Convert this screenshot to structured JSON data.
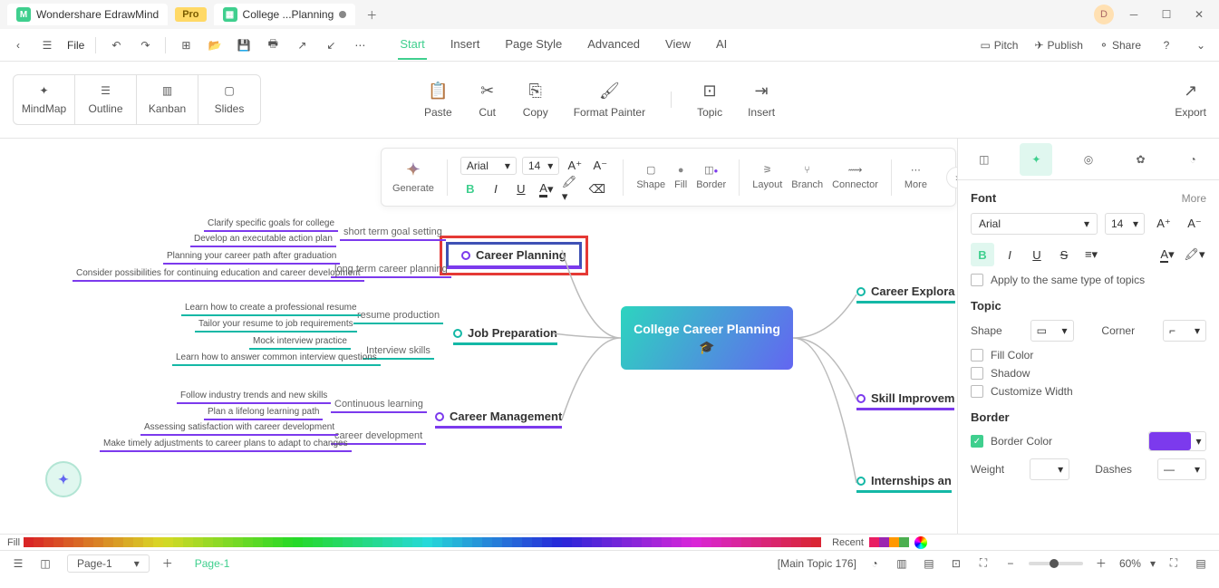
{
  "titlebar": {
    "app_name": "Wondershare EdrawMind",
    "pro_label": "Pro",
    "doc_tab": "College ...Planning",
    "user_initial": "D"
  },
  "menubar": {
    "file": "File",
    "tabs": [
      "Start",
      "Insert",
      "Page Style",
      "Advanced",
      "View",
      "AI"
    ],
    "active_tab": 0,
    "pitch": "Pitch",
    "publish": "Publish",
    "share": "Share"
  },
  "toolbar": {
    "views": [
      "MindMap",
      "Outline",
      "Kanban",
      "Slides"
    ],
    "paste": "Paste",
    "cut": "Cut",
    "copy": "Copy",
    "format_painter": "Format Painter",
    "topic": "Topic",
    "insert": "Insert",
    "export": "Export"
  },
  "float": {
    "generate": "Generate",
    "font_name": "Arial",
    "font_size": "14",
    "shape": "Shape",
    "fill": "Fill",
    "border": "Border",
    "layout": "Layout",
    "branch": "Branch",
    "connector": "Connector",
    "more": "More"
  },
  "mindmap": {
    "central": "College Career Planning",
    "career_planning": "Career Planning",
    "job_prep": "Job Preparation",
    "career_mgmt": "Career Management",
    "career_exploration": "Career Explora",
    "skill_improvement": "Skill Improvem",
    "internships": "Internships an",
    "subs": {
      "short_term": "short term goal setting",
      "long_term": "long term career planning",
      "resume": "resume production",
      "interview": "Interview skills",
      "continuous": "Continuous learning",
      "career_dev": "career development"
    },
    "leaves": {
      "l1": "Clarify specific goals for college",
      "l2": "Develop an executable action plan",
      "l3": "Planning your career path after graduation",
      "l4": "Consider possibilities for continuing education and career development",
      "l5": "Learn how to create a professional resume",
      "l6": "Tailor your resume to job requirements",
      "l7": "Mock interview practice",
      "l8": "Learn how to answer common interview questions",
      "l9": "Follow industry trends and new skills",
      "l10": "Plan a lifelong learning path",
      "l11": "Assessing satisfaction with career development",
      "l12": "Make timely adjustments to career plans to adapt to changes"
    }
  },
  "sidebar": {
    "font_header": "Font",
    "more": "More",
    "font_name": "Arial",
    "font_size": "14",
    "apply_same": "Apply to the same type of topics",
    "topic_header": "Topic",
    "shape_label": "Shape",
    "corner_label": "Corner",
    "fill_color": "Fill Color",
    "shadow": "Shadow",
    "customize_width": "Customize Width",
    "border_header": "Border",
    "border_color": "Border Color",
    "weight": "Weight",
    "dashes": "Dashes"
  },
  "colorstrip": {
    "fill": "Fill",
    "recent": "Recent"
  },
  "statusbar": {
    "page_selector": "Page-1",
    "page_active": "Page-1",
    "topic_id": "[Main Topic 176]",
    "zoom": "60%"
  },
  "chart_data": {
    "type": "mindmap",
    "title": "College Career Planning",
    "root": {
      "label": "College Career Planning",
      "children": [
        {
          "label": "Career Planning",
          "side": "left",
          "selected": true,
          "children": [
            {
              "label": "short term goal setting",
              "children": [
                {
                  "label": "Clarify specific goals for college"
                },
                {
                  "label": "Develop an executable action plan"
                }
              ]
            },
            {
              "label": "long term career planning",
              "children": [
                {
                  "label": "Planning your career path after graduation"
                },
                {
                  "label": "Consider possibilities for continuing education and career development"
                }
              ]
            }
          ]
        },
        {
          "label": "Job Preparation",
          "side": "left",
          "children": [
            {
              "label": "resume production",
              "children": [
                {
                  "label": "Learn how to create a professional resume"
                },
                {
                  "label": "Tailor your resume to job requirements"
                }
              ]
            },
            {
              "label": "Interview skills",
              "children": [
                {
                  "label": "Mock interview practice"
                },
                {
                  "label": "Learn how to answer common interview questions"
                }
              ]
            }
          ]
        },
        {
          "label": "Career Management",
          "side": "left",
          "children": [
            {
              "label": "Continuous learning",
              "children": [
                {
                  "label": "Follow industry trends and new skills"
                },
                {
                  "label": "Plan a lifelong learning path"
                }
              ]
            },
            {
              "label": "career development",
              "children": [
                {
                  "label": "Assessing satisfaction with career development"
                },
                {
                  "label": "Make timely adjustments to career plans to adapt to changes"
                }
              ]
            }
          ]
        },
        {
          "label": "Career Exploration",
          "side": "right"
        },
        {
          "label": "Skill Improvement",
          "side": "right"
        },
        {
          "label": "Internships and",
          "side": "right"
        }
      ]
    }
  }
}
